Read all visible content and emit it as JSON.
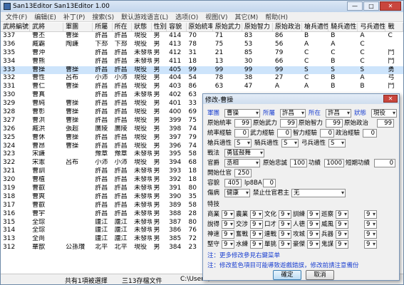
{
  "window": {
    "title": "San13Editor San13Editor 1.00"
  },
  "menu": [
    "文件(F)",
    "编辑(E)",
    "补丁(P)",
    "搜索(S)",
    "默认游戏语言(L)",
    "选项(O)",
    "视图(V)",
    "其它(M)",
    "帮助(H)"
  ],
  "grid": {
    "headers": [
      "武將編號",
      "武將",
      "軍團",
      "所屬",
      "所在",
      "狀態",
      "性別",
      "容貌",
      "原始統率",
      "原始武力",
      "原始智力",
      "原始政治",
      "槍兵適性",
      "騎兵適性",
      "弓兵適性",
      "戰"
    ],
    "rows": [
      [
        "337",
        "曹丕",
        "曹操",
        "許昌",
        "許昌",
        "現役",
        "男",
        "414",
        "70",
        "71",
        "83",
        "86",
        "B",
        "B",
        "A",
        "C"
      ],
      [
        "336",
        "臧霸",
        "陶謙",
        "下邳",
        "下邳",
        "現役",
        "男",
        "413",
        "78",
        "75",
        "53",
        "56",
        "A",
        "A",
        "C",
        ""
      ],
      [
        "335",
        "曹沖",
        "",
        "許昌",
        "許昌",
        "未發現",
        "男",
        "412",
        "31",
        "21",
        "85",
        "79",
        "C",
        "C",
        "C",
        "鬥"
      ],
      [
        "334",
        "曹熊",
        "",
        "許昌",
        "許昌",
        "未發現",
        "男",
        "411",
        "18",
        "13",
        "30",
        "66",
        "C",
        "B",
        "C",
        "鬥"
      ],
      [
        "333",
        "曹操",
        "曹操",
        "許昌",
        "許昌",
        "現役",
        "男",
        "405",
        "99",
        "99",
        "99",
        "99",
        "S",
        "S",
        "S",
        "勇"
      ],
      [
        "332",
        "曹性",
        "呂布",
        "小沛",
        "小沛",
        "現役",
        "男",
        "404",
        "54",
        "78",
        "38",
        "27",
        "C",
        "B",
        "A",
        "弓"
      ],
      [
        "331",
        "曹仁",
        "曹操",
        "許昌",
        "許昌",
        "現役",
        "男",
        "403",
        "86",
        "63",
        "47",
        "A",
        "A",
        "B",
        "B",
        "鬥"
      ],
      [
        "330",
        "曹真",
        "",
        "許昌",
        "許昌",
        "未發現",
        "男",
        "402",
        "63",
        "",
        "",
        "",
        "",
        "",
        "",
        ""
      ],
      [
        "329",
        "曹純",
        "曹操",
        "許昌",
        "許昌",
        "現役",
        "男",
        "401",
        "33",
        "",
        "",
        "",
        "",
        "",
        "",
        ""
      ],
      [
        "328",
        "曹彰",
        "曹操",
        "許昌",
        "許昌",
        "現役",
        "男",
        "400",
        "69",
        "",
        "",
        "",
        "",
        "",
        "",
        ""
      ],
      [
        "327",
        "曹洪",
        "曹操",
        "許昌",
        "許昌",
        "現役",
        "男",
        "399",
        "75",
        "",
        "",
        "",
        "",
        "",
        "",
        ""
      ],
      [
        "326",
        "臧洪",
        "張超",
        "廣陵",
        "廣陵",
        "現役",
        "男",
        "398",
        "74",
        "",
        "",
        "",
        "",
        "",
        "",
        ""
      ],
      [
        "325",
        "曹休",
        "曹操",
        "許昌",
        "許昌",
        "現役",
        "男",
        "397",
        "79",
        "",
        "",
        "",
        "",
        "",
        "",
        ""
      ],
      [
        "324",
        "曹昂",
        "曹操",
        "許昌",
        "許昌",
        "現役",
        "男",
        "396",
        "74",
        "",
        "",
        "",
        "",
        "",
        "",
        ""
      ],
      [
        "323",
        "宋謙",
        "",
        "豫章",
        "豫章",
        "未發現",
        "男",
        "395",
        "58",
        "",
        "",
        "",
        "",
        "",
        "",
        ""
      ],
      [
        "322",
        "宋憲",
        "呂布",
        "小沛",
        "小沛",
        "現役",
        "男",
        "394",
        "68",
        "",
        "",
        "",
        "",
        "",
        "",
        ""
      ],
      [
        "321",
        "曹訓",
        "",
        "許昌",
        "許昌",
        "未發現",
        "男",
        "393",
        "18",
        "",
        "",
        "",
        "",
        "",
        "",
        ""
      ],
      [
        "320",
        "曹植",
        "",
        "許昌",
        "許昌",
        "未發現",
        "男",
        "392",
        "18",
        "",
        "",
        "",
        "",
        "",
        "",
        ""
      ],
      [
        "319",
        "曹叡",
        "",
        "許昌",
        "許昌",
        "未發現",
        "男",
        "391",
        "80",
        "",
        "",
        "",
        "",
        "",
        "",
        ""
      ],
      [
        "318",
        "曹爽",
        "",
        "許昌",
        "許昌",
        "未發現",
        "男",
        "390",
        "35",
        "",
        "",
        "",
        "",
        "",
        "",
        ""
      ],
      [
        "317",
        "曹叡",
        "",
        "許昌",
        "許昌",
        "未發現",
        "男",
        "389",
        "58",
        "",
        "",
        "",
        "",
        "",
        "",
        ""
      ],
      [
        "316",
        "曹宇",
        "",
        "許昌",
        "許昌",
        "未發現",
        "男",
        "388",
        "28",
        "",
        "",
        "",
        "",
        "",
        "",
        ""
      ],
      [
        "315",
        "全琮",
        "",
        "廬江",
        "廬江",
        "未發現",
        "男",
        "387",
        "80",
        "",
        "",
        "",
        "",
        "",
        "",
        ""
      ],
      [
        "314",
        "全琮",
        "",
        "廬江",
        "廬江",
        "未發現",
        "男",
        "386",
        "76",
        "",
        "",
        "",
        "",
        "",
        "",
        ""
      ],
      [
        "313",
        "全尚",
        "",
        "廬江",
        "廬江",
        "未發現",
        "男",
        "385",
        "72",
        "",
        "",
        "",
        "",
        "",
        "",
        ""
      ],
      [
        "312",
        "華歆",
        "公孫瓚",
        "北平",
        "北平",
        "現役",
        "男",
        "384",
        "23",
        "",
        "",
        "",
        "",
        "",
        "",
        ""
      ]
    ],
    "selected_row": 4
  },
  "status": {
    "selected": "共有1項被選擇",
    "count": "三13存檔文件",
    "path": "C:\\Users\\"
  },
  "dialog": {
    "title": "修改-曹操",
    "close": "✕",
    "army_label": "軍團",
    "army_value": "曹操",
    "belong_label": "所屬",
    "belong_value": "許昌",
    "location_label": "所在",
    "location_value": "許昌",
    "status_label": "狀態",
    "status_value": "現役",
    "lead_label": "原始統率",
    "lead_value": "99",
    "war_label": "原始武力",
    "war_value": "99",
    "int_label": "原始智力",
    "int_value": "99",
    "pol_label": "原始政治",
    "pol_value": "99",
    "lead_exp_label": "統率經驗",
    "lead_exp_value": "0",
    "war_exp_label": "武力經驗",
    "war_exp_value": "0",
    "int_exp_label": "智力經驗",
    "int_exp_value": "0",
    "pol_exp_label": "政治經驗",
    "pol_exp_value": "0",
    "spear_label": "槍兵適性",
    "spear_value": "S",
    "cavalry_label": "騎兵適性",
    "cavalry_value": "S",
    "bow_label": "弓兵適性",
    "bow_value": "S",
    "tactic_label": "戰法",
    "tactic_value": "勇猛鼓舞",
    "rank_label": "官爵",
    "rank_value": "丞相",
    "loyalty_label": "原始忠誠",
    "loyalty_value": "100",
    "merit_label": "功績",
    "merit_value": "1000",
    "short_merit_label": "短期功績",
    "short_merit_value": "0",
    "debut_label": "開始仕官",
    "debut_value": "250",
    "face_label": "容貌",
    "face_value": "405",
    "face_code": "lp8BA",
    "face_code_value": "0",
    "health_label": "傷病",
    "health_value": "健康",
    "ban_label": "禁止仕官君主",
    "ban_value": "无",
    "skills_label": "特技",
    "skills": [
      [
        {
          "n": "9",
          "t": "商業"
        },
        {
          "n": "9",
          "t": "農業"
        },
        {
          "n": "9",
          "t": "文化"
        },
        {
          "n": "9",
          "t": "訓練"
        },
        {
          "n": "9",
          "t": "巡察"
        },
        {
          "n": "9",
          "t": ""
        }
      ],
      [
        {
          "n": "9",
          "t": "說得"
        },
        {
          "n": "9",
          "t": "交涉"
        },
        {
          "n": "9",
          "t": "口才"
        },
        {
          "n": "9",
          "t": "人德"
        },
        {
          "n": "9",
          "t": "威風"
        },
        {
          "n": "9",
          "t": ""
        }
      ],
      [
        {
          "n": "9",
          "t": "神速"
        },
        {
          "n": "9",
          "t": "奮戰"
        },
        {
          "n": "9",
          "t": "連戰"
        },
        {
          "n": "9",
          "t": "攻城"
        },
        {
          "n": "9",
          "t": "兵器"
        },
        {
          "n": "9",
          "t": ""
        }
      ],
      [
        {
          "n": "9",
          "t": "堅守"
        },
        {
          "n": "9",
          "t": "水練"
        },
        {
          "n": "9",
          "t": "單挑"
        },
        {
          "n": "9",
          "t": "豪傑"
        },
        {
          "n": "9",
          "t": "鬼謀"
        },
        {
          "n": "9",
          "t": ""
        }
      ]
    ],
    "note1": "注：更多修改參見右鍵菜单",
    "note2": "注：修改藍色項目可能導致遊戲錯誤，修改前請注意備份",
    "ok": "確定",
    "cancel": "取消"
  }
}
